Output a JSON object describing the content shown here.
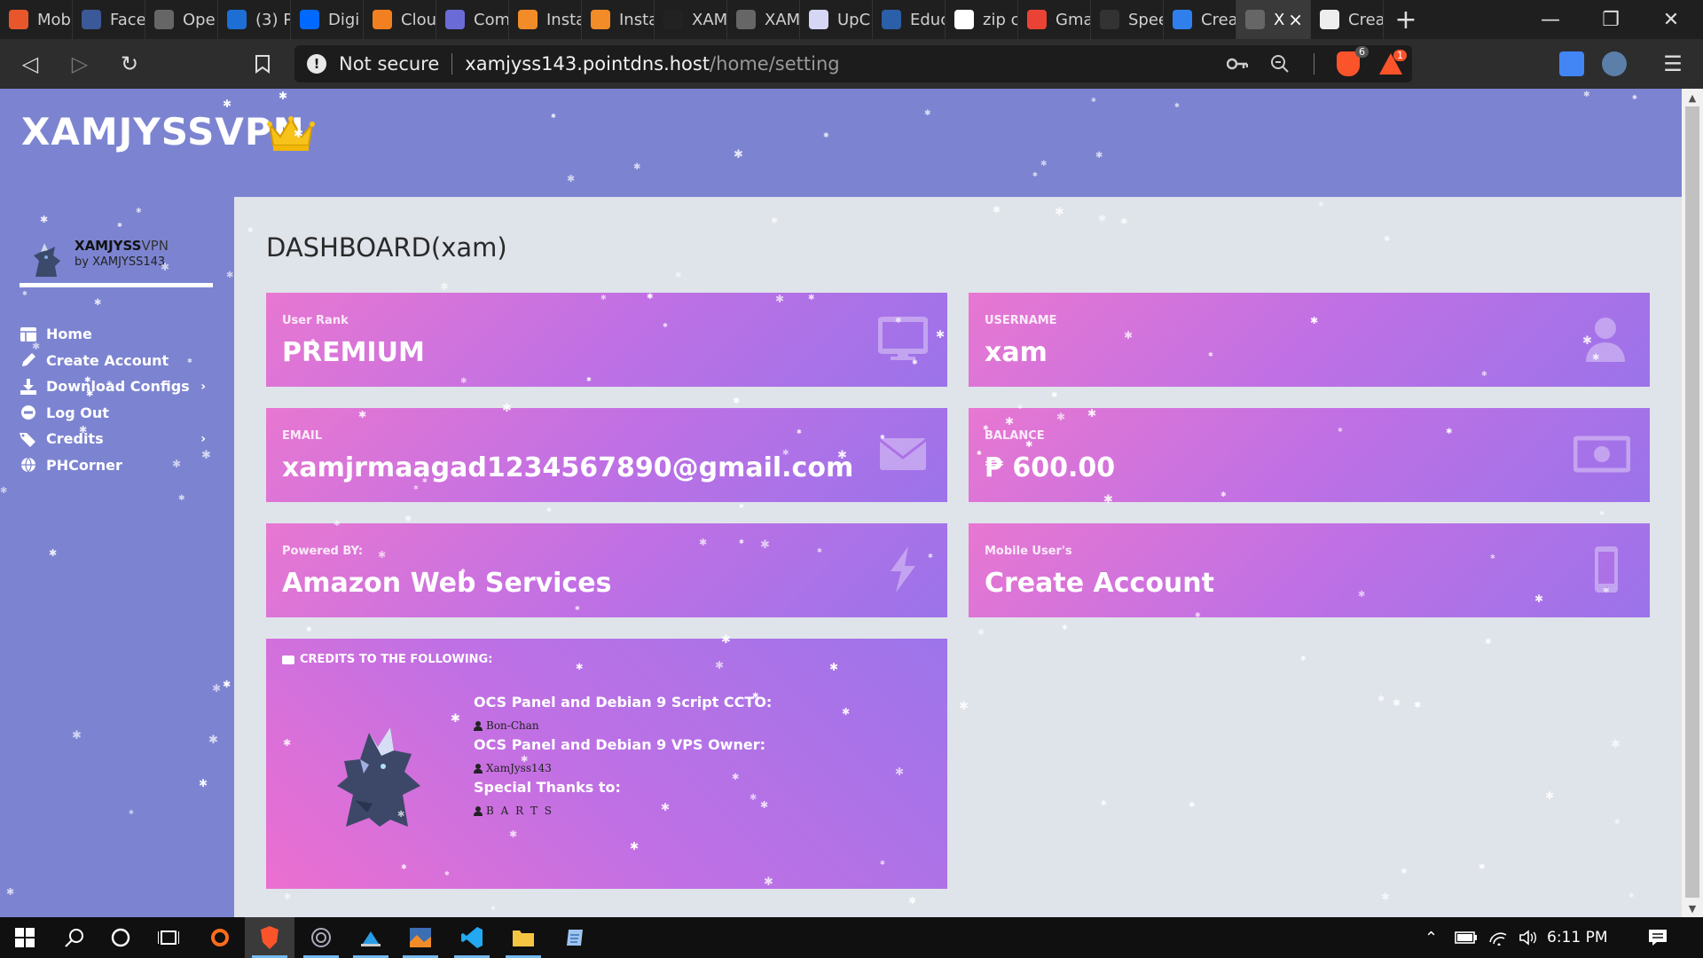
{
  "browser": {
    "tabs": [
      {
        "label": "Mob",
        "color": "#e8572c"
      },
      {
        "label": "Face",
        "color": "#3b5998"
      },
      {
        "label": "Ope",
        "color": "#666666"
      },
      {
        "label": "(3) P",
        "color": "#1d6fd6"
      },
      {
        "label": "Digi",
        "color": "#0069ff"
      },
      {
        "label": "Clou",
        "color": "#f38020"
      },
      {
        "label": "Com",
        "color": "#6b6bd8"
      },
      {
        "label": "Insta",
        "color": "#f28c28"
      },
      {
        "label": "Insta",
        "color": "#f28c28"
      },
      {
        "label": "XAM",
        "color": "#222222"
      },
      {
        "label": "XAM",
        "color": "#666666"
      },
      {
        "label": "UpC",
        "color": "#d6d6f5"
      },
      {
        "label": "Educ",
        "color": "#2b5fa8"
      },
      {
        "label": "zip c",
        "color": "#ffffff"
      },
      {
        "label": "Gma",
        "color": "#ea4335"
      },
      {
        "label": "Spee",
        "color": "#333333"
      },
      {
        "label": "Crea",
        "color": "#2f80ed"
      },
      {
        "label": "X",
        "color": "#666666"
      },
      {
        "label": "Crea",
        "color": "#eeeeee"
      }
    ],
    "active_tab_index": 17,
    "new_tab_label": "+",
    "security_label": "Not secure",
    "url_host": "xamjyss143.pointdns.host",
    "url_path": "/home/setting",
    "brave_shield_count": "6",
    "rewards_count": "1"
  },
  "header": {
    "brand": "XAMJYSSVPN"
  },
  "sidebar": {
    "user_name_bold": "XAMJYSS",
    "user_name_thin": "VPN",
    "user_by": "by XAMJYSS143",
    "items": [
      {
        "label": "Home",
        "icon": "dashboard-icon"
      },
      {
        "label": "Create Account",
        "icon": "pencil-icon"
      },
      {
        "label": "Download Configs",
        "icon": "download-icon"
      },
      {
        "label": "Log Out",
        "icon": "minus-circle-icon"
      },
      {
        "label": "Credits",
        "icon": "tags-icon"
      },
      {
        "label": "PHCorner",
        "icon": "globe-icon"
      }
    ]
  },
  "main": {
    "title": "DASHBOARD(xam)",
    "cards": [
      {
        "label": "User Rank",
        "value": "PREMIUM",
        "icon": "monitor-icon"
      },
      {
        "label": "USERNAME",
        "value": "xam",
        "icon": "user-icon"
      },
      {
        "label": "EMAIL",
        "value": "xamjrmaagad1234567890@gmail.com",
        "icon": "envelope-icon"
      },
      {
        "label": "BALANCE",
        "value": "₱ 600.00",
        "icon": "money-icon"
      },
      {
        "label": "Powered BY:",
        "value": "Amazon Web Services",
        "icon": "bolt-icon"
      },
      {
        "label": "Mobile User's",
        "value": "Create Account",
        "icon": "mobile-icon"
      }
    ],
    "credits": {
      "heading": "CREDITS TO THE FOLLOWING:",
      "lines": [
        {
          "title": "OCS Panel and Debian 9 Script CCTO:",
          "name": "Bon-Chan"
        },
        {
          "title": "OCS Panel and Debian 9 VPS Owner:",
          "name": "XamJyss143"
        },
        {
          "title": "Special Thanks to:",
          "name": "B A R T S"
        }
      ]
    }
  },
  "taskbar": {
    "clock": "6:11 PM"
  },
  "colors": {
    "header_bg": "#7c84d1",
    "page_bg": "#dfe3ea",
    "card_pink": "#e877d1",
    "card_purple": "#9b73ea"
  }
}
